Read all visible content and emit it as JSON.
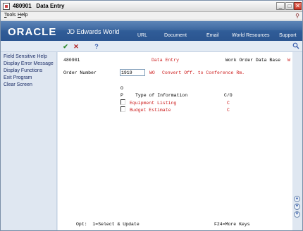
{
  "window": {
    "program_id": "480901",
    "title": "Data Entry",
    "minimize": "_",
    "maximize": "□",
    "close": "✕"
  },
  "menu": {
    "items": [
      "Tools",
      "Help"
    ]
  },
  "banner": {
    "oracle": "ORACLE",
    "product": "JD Edwards World",
    "links": [
      "URL",
      "Document",
      "Email",
      "World Resources",
      "Support"
    ]
  },
  "toolbar": {
    "ok": "✔",
    "cancel": "✕",
    "help": "?"
  },
  "exits": [
    "Field Sensitive Help",
    "Display Error Message",
    "Display Functions",
    "Exit Program",
    "Clear Screen"
  ],
  "form": {
    "program_id": "480901",
    "form_title": "Data Entry",
    "database": "Work Order Data Base",
    "marker": "W",
    "order_label": "Order Number",
    "order_value": "1919",
    "order_type": "WO",
    "order_description": "Convert Off. to Conference Rm.",
    "header_o": "O",
    "header_p": "P",
    "header_type": "Type of Information",
    "header_co": "C/O",
    "rows": [
      {
        "label": "Equipment Listing",
        "co": "C"
      },
      {
        "label": "Budget Estimate",
        "co": "C"
      }
    ],
    "footer_opt": "Opt:  1=Select & Update",
    "footer_keys": "F24=More Keys"
  }
}
